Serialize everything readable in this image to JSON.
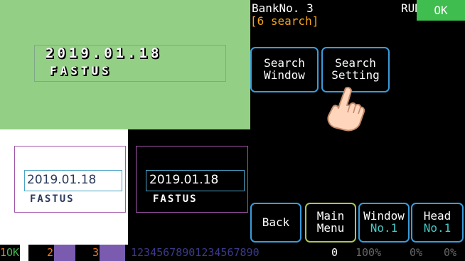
{
  "header": {
    "bank_label": "BankNo. 3",
    "search_count": "[6 search]",
    "mode": "RUN",
    "result": "OK"
  },
  "inspection_image": {
    "date_text": "2019.01.18",
    "name_text": "FASTUS"
  },
  "samples": [
    {
      "date": "2019.01.18",
      "name": "FASTUS"
    },
    {
      "date": "2019.01.18",
      "name": "FASTUS"
    }
  ],
  "buttons": {
    "search_window": [
      "Search",
      "Window"
    ],
    "search_setting": [
      "Search",
      "Setting"
    ],
    "back": "Back",
    "main_menu": [
      "Main",
      "Menu"
    ],
    "window": [
      "Window",
      "No.1"
    ],
    "head": [
      "Head",
      "No.1"
    ]
  },
  "status_bar": {
    "slot1_index": "1",
    "slot1_value": "OK",
    "slot2_index": "2",
    "slot3_index": "3",
    "digits": "12345678901234567890",
    "count": "0",
    "percent1": "100%",
    "percent2": "0%",
    "percent3": "0%"
  },
  "colors": {
    "ok_green": "#3fbd4f",
    "button_blue": "#3a9cdb",
    "button_green": "#a8c65a",
    "search_orange": "#f2a31b",
    "image_green": "#94cf86"
  },
  "icons": {
    "pointer": "hand-pointer-icon"
  }
}
